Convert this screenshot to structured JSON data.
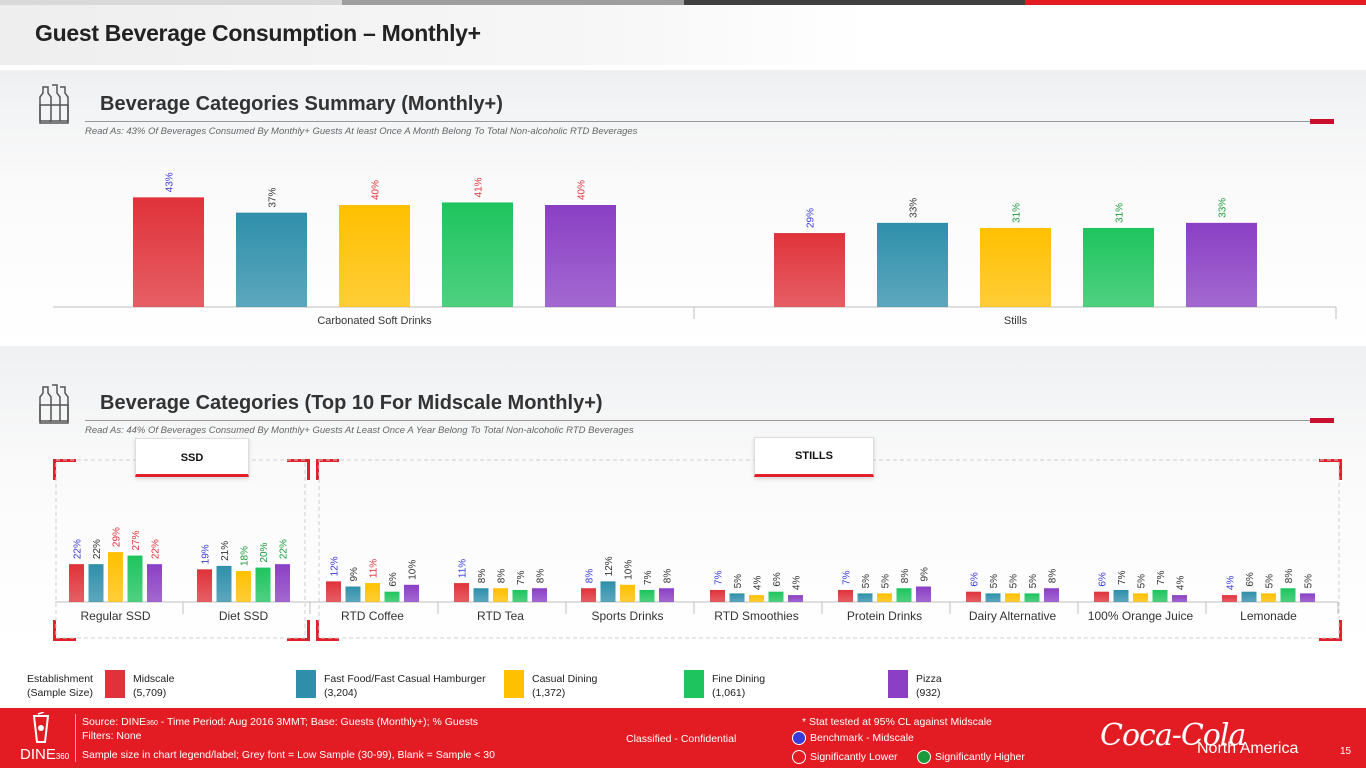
{
  "page": {
    "title": "Guest Beverage Consumption – Monthly+"
  },
  "colors": {
    "midscale": "#e0323a",
    "fast_food": "#2f8fab",
    "casual": "#ffc000",
    "fine": "#1ec45e",
    "pizza": "#8a3fc4",
    "accent_red": "#e31b23",
    "sig_lower": "#3a3adb",
    "sig_higher": "#1a9a3a"
  },
  "section1": {
    "title": "Beverage Categories Summary (Monthly+)",
    "read_as": "Read As: 43% Of Beverages Consumed By Monthly+ Guests At least Once A Month Belong To Total Non-alcoholic RTD Beverages",
    "icon": "beverage-bottles-icon"
  },
  "section2": {
    "title": "Beverage Categories (Top 10 For Midscale Monthly+)",
    "read_as": "Read As: 44% Of Beverages Consumed By Monthly+ Guests At Least Once A Year Belong To Total Non-alcoholic RTD Beverages",
    "icon": "beverage-bottles-icon",
    "tab_ssd": "SSD",
    "tab_stills": "STILLS"
  },
  "chart_data": [
    {
      "type": "bar",
      "title": "Beverage Categories Summary (Monthly+)",
      "categories": [
        "Carbonated Soft Drinks",
        "Stills"
      ],
      "series": [
        {
          "name": "Midscale",
          "values": [
            43,
            29
          ],
          "label_color": [
            "lower",
            "lower"
          ]
        },
        {
          "name": "Fast Food/Fast Casual Hamburger",
          "values": [
            37,
            33
          ],
          "label_color": [
            "neutral",
            "neutral"
          ]
        },
        {
          "name": "Casual Dining",
          "values": [
            40,
            31
          ],
          "label_color": [
            "higher_red",
            "higher"
          ]
        },
        {
          "name": "Fine Dining",
          "values": [
            41,
            31
          ],
          "label_color": [
            "higher_red",
            "higher"
          ]
        },
        {
          "name": "Pizza",
          "values": [
            40,
            33
          ],
          "label_color": [
            "higher_red",
            "higher"
          ]
        }
      ],
      "value_suffix": "%",
      "ylim": [
        0,
        60
      ]
    },
    {
      "type": "bar",
      "title": "Beverage Categories (Top 10 For Midscale Monthly+)",
      "categories": [
        "Regular SSD",
        "Diet SSD",
        "RTD Coffee",
        "RTD Tea",
        "Sports Drinks",
        "RTD Smoothies",
        "Protein Drinks",
        "Dairy Alternative",
        "100% Orange Juice",
        "Lemonade"
      ],
      "series": [
        {
          "name": "Midscale",
          "values": [
            22,
            19,
            12,
            11,
            8,
            7,
            7,
            6,
            6,
            4
          ],
          "label_color": [
            "lower",
            "lower",
            "lower",
            "lower",
            "lower",
            "lower",
            "lower",
            "lower",
            "lower",
            "lower"
          ]
        },
        {
          "name": "Fast Food/Fast Casual Hamburger",
          "values": [
            22,
            21,
            9,
            8,
            12,
            5,
            5,
            5,
            7,
            6
          ],
          "label_color": [
            "neutral",
            "neutral",
            "neutral",
            "neutral",
            "neutral",
            "neutral",
            "neutral",
            "neutral",
            "neutral",
            "neutral"
          ]
        },
        {
          "name": "Casual Dining",
          "values": [
            29,
            18,
            11,
            8,
            10,
            4,
            5,
            5,
            5,
            5
          ],
          "label_color": [
            "higher_red",
            "higher",
            "higher_red",
            "neutral",
            "neutral",
            "neutral",
            "neutral",
            "neutral",
            "neutral",
            "neutral"
          ]
        },
        {
          "name": "Fine Dining",
          "values": [
            27,
            20,
            6,
            7,
            7,
            6,
            8,
            5,
            7,
            8
          ],
          "label_color": [
            "higher_red",
            "higher",
            "neutral",
            "neutral",
            "neutral",
            "neutral",
            "neutral",
            "neutral",
            "neutral",
            "neutral"
          ]
        },
        {
          "name": "Pizza",
          "values": [
            22,
            22,
            10,
            8,
            8,
            4,
            9,
            8,
            4,
            5
          ],
          "label_color": [
            "higher_red",
            "higher",
            "neutral",
            "neutral",
            "neutral",
            "neutral",
            "neutral",
            "neutral",
            "neutral",
            "neutral"
          ]
        }
      ],
      "value_suffix": "%",
      "ylim": [
        0,
        60
      ]
    }
  ],
  "legend": {
    "title_line1": "Establishment",
    "title_line2": "(Sample Size)",
    "items": [
      {
        "name": "Midscale",
        "size": "(5,709)"
      },
      {
        "name": "Fast Food/Fast Casual Hamburger",
        "size": "(3,204)"
      },
      {
        "name": "Casual Dining",
        "size": "(1,372)"
      },
      {
        "name": "Fine Dining",
        "size": "(1,061)"
      },
      {
        "name": "Pizza",
        "size": "(932)"
      }
    ]
  },
  "footer": {
    "source_prefix": "Source: DINE",
    "source_sub": "360",
    "source_rest": " - Time Period: Aug 2016 3MMT; Base: Guests (Monthly+); % Guests",
    "filters": "Filters: None",
    "sample_note": "Sample size in chart legend/label;  Grey font = Low Sample (30-99), Blank = Sample < 30",
    "classified": "Classified - Confidential",
    "stat_note": "* Stat tested at 95% CL against Midscale",
    "benchmark": "Benchmark - Midscale",
    "sig_lower": "Significantly Lower",
    "sig_higher": "Significantly Higher",
    "logo_text": "DINE",
    "logo_sub": "360",
    "brand": "Coca-Cola",
    "brand_region": "North America",
    "page_number": "15"
  }
}
